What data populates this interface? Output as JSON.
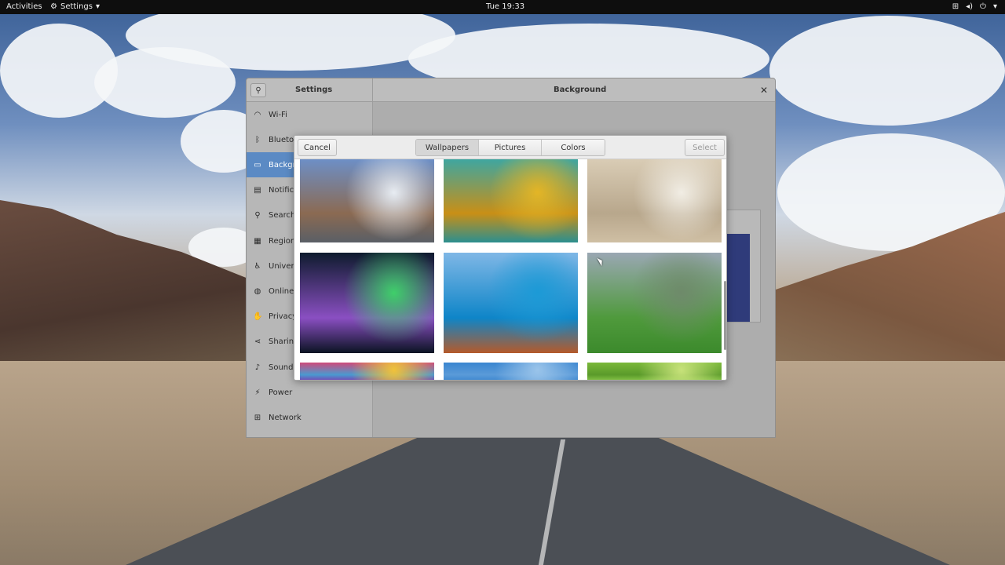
{
  "topbar": {
    "activities": "Activities",
    "app_name": "Settings",
    "clock": "Tue 19:33"
  },
  "window": {
    "left_title": "Settings",
    "right_title": "Background"
  },
  "sidebar": {
    "items": [
      {
        "label": "Wi-Fi",
        "icon": "wifi-icon",
        "glyph": "◠"
      },
      {
        "label": "Bluetoo",
        "icon": "bluetooth-icon",
        "glyph": "ᛒ"
      },
      {
        "label": "Backgro",
        "icon": "background-icon",
        "glyph": "▭"
      },
      {
        "label": "Notifica",
        "icon": "notifications-icon",
        "glyph": "▤"
      },
      {
        "label": "Search",
        "icon": "search-icon",
        "glyph": "⚲"
      },
      {
        "label": "Region",
        "icon": "region-icon",
        "glyph": "▦"
      },
      {
        "label": "Univers",
        "icon": "universal-access-icon",
        "glyph": "♿"
      },
      {
        "label": "Online A",
        "icon": "online-accounts-icon",
        "glyph": "◍"
      },
      {
        "label": "Privacy",
        "icon": "privacy-icon",
        "glyph": "✋"
      },
      {
        "label": "Sharing",
        "icon": "sharing-icon",
        "glyph": "⋖"
      },
      {
        "label": "Sound",
        "icon": "sound-icon",
        "glyph": "♪"
      },
      {
        "label": "Power",
        "icon": "power-icon",
        "glyph": "⚡"
      },
      {
        "label": "Network",
        "icon": "network-icon",
        "glyph": "⊞"
      }
    ],
    "active_index": 2
  },
  "dialog": {
    "cancel_label": "Cancel",
    "select_label": "Select",
    "tabs": [
      "Wallpapers",
      "Pictures",
      "Colors"
    ],
    "active_tab": 0
  },
  "wallpapers": [
    {
      "name": "road-mountains",
      "colors": [
        "#6d8fc6",
        "#e7ecf2",
        "#8b6a52",
        "#5a5f66"
      ]
    },
    {
      "name": "yellow-frog",
      "colors": [
        "#3fa6a0",
        "#e3b526",
        "#c98f16",
        "#2c8f8f"
      ]
    },
    {
      "name": "zen-stones",
      "colors": [
        "#d9ccb5",
        "#f1ede4",
        "#b8a78c",
        "#cfbfa4"
      ]
    },
    {
      "name": "aurora",
      "colors": [
        "#0e1b2e",
        "#3fcf6a",
        "#8a4fc2",
        "#0a1322"
      ]
    },
    {
      "name": "ocean-boat",
      "colors": [
        "#7fb7e6",
        "#1c9ad6",
        "#0e85c8",
        "#b55a2a"
      ]
    },
    {
      "name": "alpine-meadow",
      "colors": [
        "#9aa7b3",
        "#6e8a6a",
        "#4f9a3c",
        "#3c8a2c"
      ]
    },
    {
      "name": "colorful-pebbles",
      "colors": [
        "#d04a7a",
        "#f0c23a",
        "#4a9ad0",
        "#7a3ab0"
      ]
    },
    {
      "name": "blue-sky",
      "colors": [
        "#3a86d0",
        "#9ac4ea",
        "#5a9ad8",
        "#3a86d0"
      ]
    },
    {
      "name": "green-bokeh",
      "colors": [
        "#7ab83a",
        "#c7e27a",
        "#5a9a2a",
        "#8ac84a"
      ]
    }
  ]
}
